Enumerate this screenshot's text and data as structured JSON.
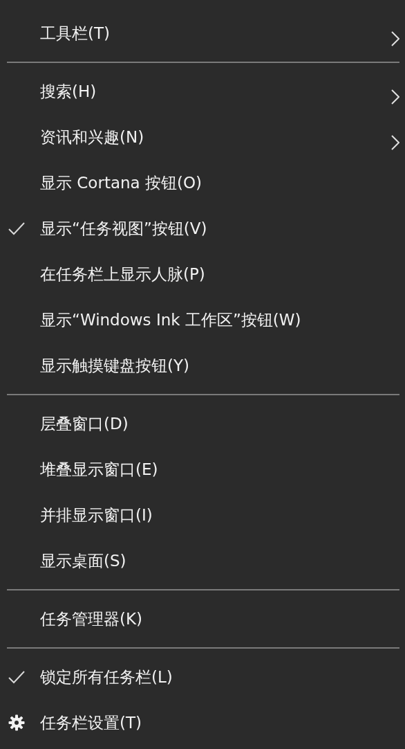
{
  "menu": [
    {
      "kind": "item",
      "label": "工具栏(T)",
      "checked": false,
      "submenu": true
    },
    {
      "kind": "separator"
    },
    {
      "kind": "item",
      "label": "搜索(H)",
      "checked": false,
      "submenu": true
    },
    {
      "kind": "item",
      "label": "资讯和兴趣(N)",
      "checked": false,
      "submenu": true
    },
    {
      "kind": "item",
      "label": "显示 Cortana 按钮(O)",
      "checked": false,
      "submenu": false
    },
    {
      "kind": "item",
      "label": "显示“任务视图”按钮(V)",
      "checked": true,
      "submenu": false
    },
    {
      "kind": "item",
      "label": "在任务栏上显示人脉(P)",
      "checked": false,
      "submenu": false
    },
    {
      "kind": "item",
      "label": "显示“Windows Ink 工作区”按钮(W)",
      "checked": false,
      "submenu": false
    },
    {
      "kind": "item",
      "label": "显示触摸键盘按钮(Y)",
      "checked": false,
      "submenu": false
    },
    {
      "kind": "separator"
    },
    {
      "kind": "item",
      "label": "层叠窗口(D)",
      "checked": false,
      "submenu": false
    },
    {
      "kind": "item",
      "label": "堆叠显示窗口(E)",
      "checked": false,
      "submenu": false
    },
    {
      "kind": "item",
      "label": "并排显示窗口(I)",
      "checked": false,
      "submenu": false
    },
    {
      "kind": "item",
      "label": "显示桌面(S)",
      "checked": false,
      "submenu": false
    },
    {
      "kind": "separator"
    },
    {
      "kind": "item",
      "label": "任务管理器(K)",
      "checked": false,
      "submenu": false
    },
    {
      "kind": "separator"
    },
    {
      "kind": "item",
      "label": "锁定所有任务栏(L)",
      "checked": true,
      "submenu": false
    },
    {
      "kind": "settings",
      "label": "任务栏设置(T)",
      "checked": false,
      "submenu": false
    }
  ]
}
